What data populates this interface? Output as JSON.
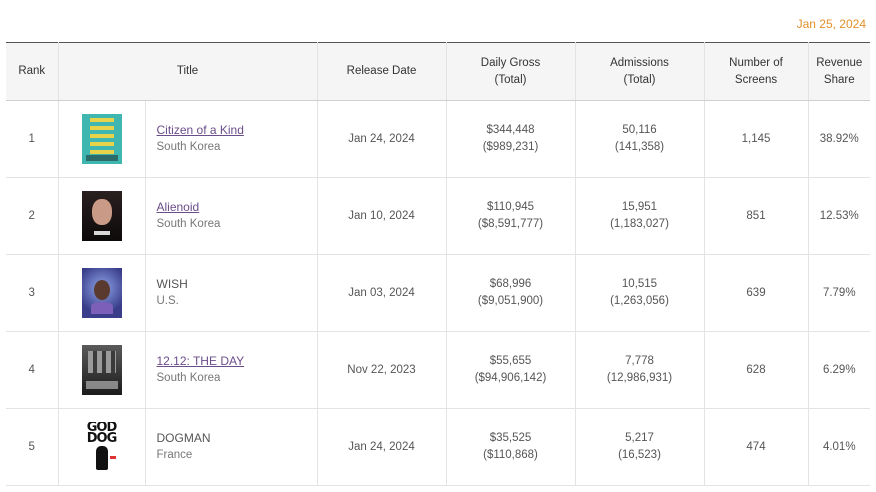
{
  "date": "Jan 25, 2024",
  "headers": {
    "rank": "Rank",
    "title": "Title",
    "release": "Release Date",
    "gross_l1": "Daily Gross",
    "gross_l2": "(Total)",
    "adm_l1": "Admissions",
    "adm_l2": "(Total)",
    "screens": "Number of Screens",
    "share_l1": "Revenue",
    "share_l2": "Share"
  },
  "rows": [
    {
      "rank": "1",
      "title": "Citizen of a Kind",
      "country": "South Korea",
      "release": "Jan 24, 2024",
      "gross": "$344,448",
      "gross_total": "($989,231)",
      "adm": "50,116",
      "adm_total": "(141,358)",
      "screens": "1,145",
      "share": "38.92%"
    },
    {
      "rank": "2",
      "title": "Alienoid",
      "country": "South Korea",
      "release": "Jan 10, 2024",
      "gross": "$110,945",
      "gross_total": "($8,591,777)",
      "adm": "15,951",
      "adm_total": "(1,183,027)",
      "screens": "851",
      "share": "12.53%"
    },
    {
      "rank": "3",
      "title": "WISH",
      "country": "U.S.",
      "release": "Jan 03, 2024",
      "gross": "$68,996",
      "gross_total": "($9,051,900)",
      "adm": "10,515",
      "adm_total": "(1,263,056)",
      "screens": "639",
      "share": "7.79%"
    },
    {
      "rank": "4",
      "title": "12.12: THE DAY",
      "country": "South Korea",
      "release": "Nov 22, 2023",
      "gross": "$55,655",
      "gross_total": "($94,906,142)",
      "adm": "7,778",
      "adm_total": "(12,986,931)",
      "screens": "628",
      "share": "6.29%"
    },
    {
      "rank": "5",
      "title": "DOGMAN",
      "country": "France",
      "release": "Jan 24, 2024",
      "gross": "$35,525",
      "gross_total": "($110,868)",
      "adm": "5,217",
      "adm_total": "(16,523)",
      "screens": "474",
      "share": "4.01%"
    }
  ],
  "poster_text": {
    "line1": "GOD",
    "line2": "DOG"
  }
}
